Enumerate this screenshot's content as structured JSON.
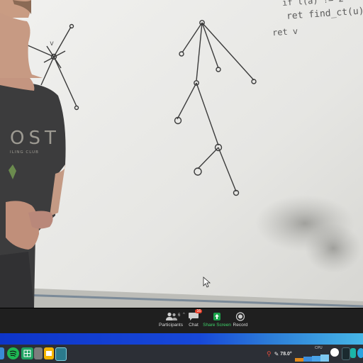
{
  "whiteboard": {
    "code_line_1": "if l(a) != 2",
    "code_line_2": "ret find_ct(u)",
    "code_line_3": "ret v",
    "node_label": "v"
  },
  "presenter": {
    "shirt_text_main": "OST",
    "shirt_text_sub": "ILING CLUB"
  },
  "toolbar": {
    "participants_label": "Participants",
    "participants_count": "6",
    "chat_label": "Chat",
    "chat_badge": "16",
    "share_label": "Share Screen",
    "record_label": "Record"
  },
  "taskbar": {
    "temperature": "78.0°",
    "cpu_label": "CPU"
  },
  "colors": {
    "toolbar_bg": "#1f1f1f",
    "share_green": "#1aa34a",
    "chat_badge_red": "#e8412c",
    "blue_bar": "#1748d8",
    "taskbar_bg": "#2c2f36"
  },
  "icons": [
    "participants-icon",
    "chat-icon",
    "share-screen-icon",
    "record-icon",
    "spotify-icon",
    "sheets-icon",
    "files-icon",
    "slides-icon",
    "game-icon",
    "location-icon",
    "thermometer-icon"
  ]
}
